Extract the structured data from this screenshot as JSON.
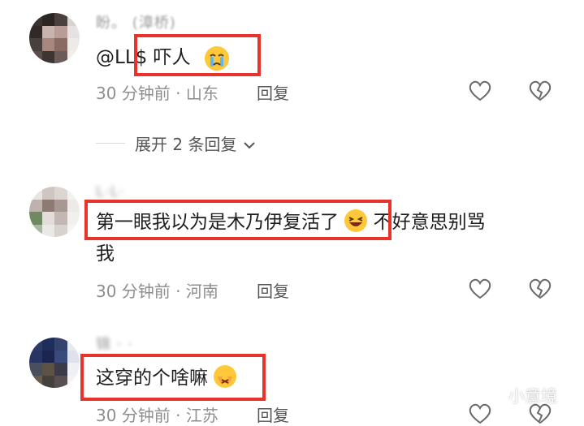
{
  "comments": [
    {
      "username": "盼。 (漳桥)",
      "text": "@LL$ 吓人",
      "time_location": "30 分钟前 · 山东",
      "reply_label": "回复",
      "expand_label": "展开 2 条回复"
    },
    {
      "username": "L·L·",
      "text_line1": "第一眼我以为是木乃伊复活了",
      "text_after_emoji": "不好意思别骂",
      "text_line2": "我",
      "time_location": "30 分钟前 · 河南",
      "reply_label": "回复"
    },
    {
      "username": "锦 · ·",
      "text": "这穿的个啥嘛",
      "time_location": "30 分钟前 · 江苏",
      "reply_label": "回复"
    }
  ],
  "watermark": "小意境",
  "colors": {
    "highlight_box": "#e8322b",
    "meta_text": "#8e8e8e",
    "emoji": "#ffc83a"
  }
}
